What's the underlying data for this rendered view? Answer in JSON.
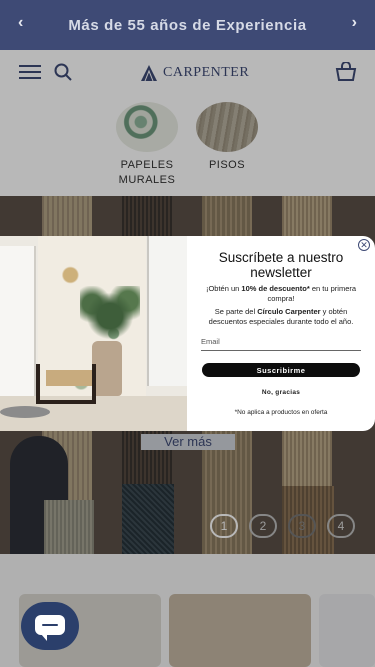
{
  "announcement": {
    "text": "Más de 55 años de Experiencia",
    "prev_icon": "chevron-left-icon",
    "next_icon": "chevron-right-icon"
  },
  "header": {
    "logo_text": "CARPENTER",
    "menu_icon": "hamburger-icon",
    "search_icon": "search-icon",
    "cart_icon": "cart-icon"
  },
  "categories": [
    {
      "label": "PAPELES MURALES"
    },
    {
      "label": "PISOS"
    }
  ],
  "hero": {
    "cta_label": "Ver más",
    "slides": [
      "1",
      "2",
      "3",
      "4"
    ],
    "active_slide": 1
  },
  "popup": {
    "title": "Suscríbete a nuestro newsletter",
    "offer_pre": "¡Obtén un ",
    "offer_bold": "10% de descuento*",
    "offer_post": " en tu primera compra!",
    "member_pre": "Se parte del ",
    "member_bold": "Círculo Carpenter",
    "member_post": " y obtén descuentos especiales durante todo el año.",
    "email_placeholder": "Email",
    "subscribe_label": "Suscribirme",
    "decline_label": "No, gracias",
    "footnote": "*No aplica a productos en oferta",
    "close_icon": "close-icon"
  },
  "chat": {
    "icon": "chat-icon"
  },
  "colors": {
    "brand_navy": "#3e4a75",
    "button_black": "#0d0d0d"
  }
}
